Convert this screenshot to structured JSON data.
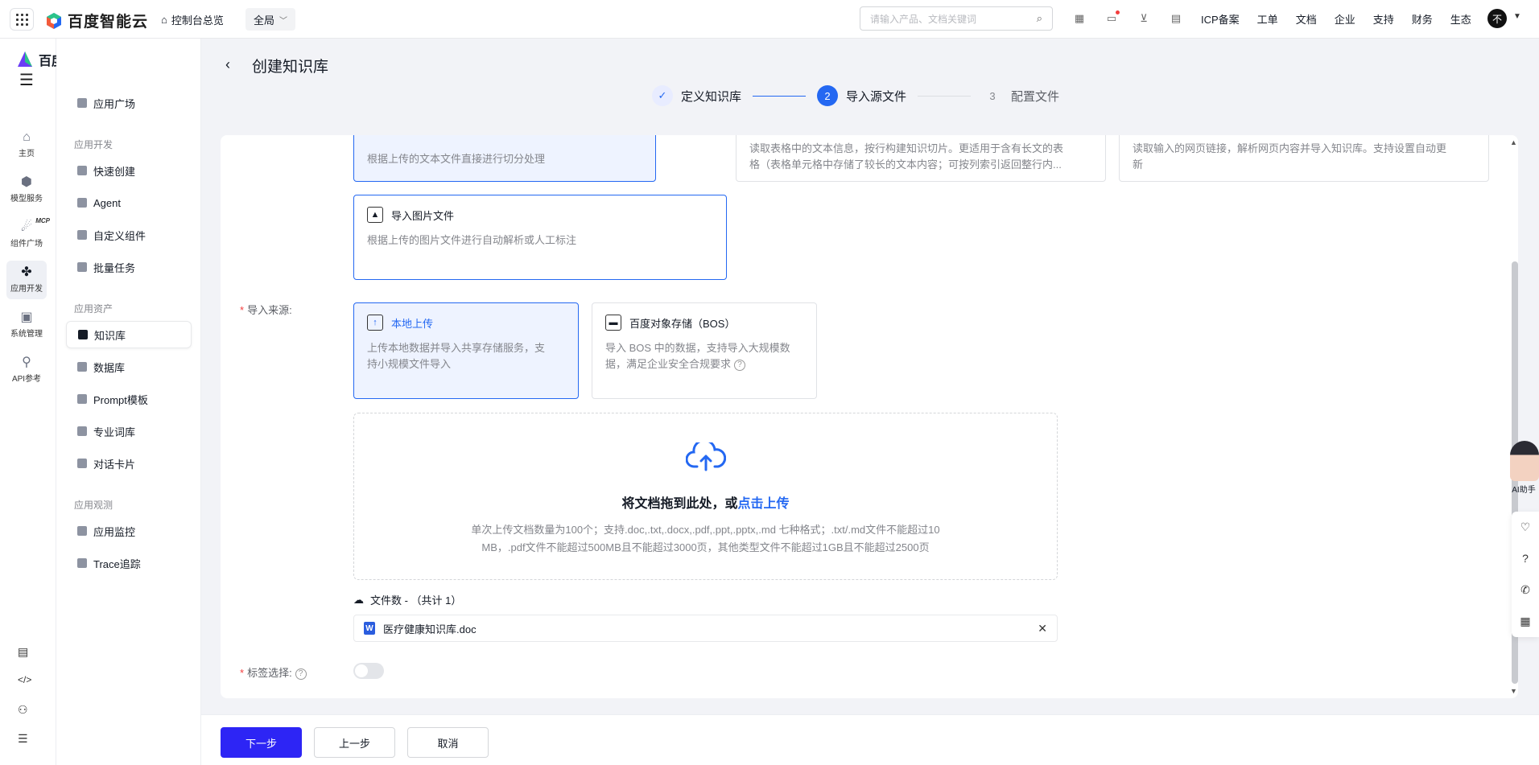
{
  "topbar": {
    "brand": "百度智能云",
    "console_label": "控制台总览",
    "region": "全局",
    "search_placeholder": "请输入产品、文档关键词",
    "links": [
      "ICP备案",
      "工单",
      "文档",
      "企业",
      "支持",
      "财务",
      "生态"
    ],
    "avatar_text": "不"
  },
  "rail": {
    "brand": "百度千帆",
    "items": [
      "主页",
      "模型服务",
      "组件广场",
      "应用开发",
      "系统管理",
      "API参考"
    ],
    "mcp_badge": "MCP"
  },
  "sidenav": {
    "top_item": "应用广场",
    "group_dev": "应用开发",
    "dev_items": [
      "快速创建",
      "Agent",
      "自定义组件",
      "批量任务"
    ],
    "group_assets": "应用资产",
    "asset_items": [
      "知识库",
      "数据库",
      "Prompt模板",
      "专业词库",
      "对话卡片"
    ],
    "group_observe": "应用观测",
    "observe_items": [
      "应用监控",
      "Trace追踪"
    ]
  },
  "page": {
    "title": "创建知识库",
    "steps": [
      {
        "num": "✓",
        "label": "定义知识库"
      },
      {
        "num": "2",
        "label": "导入源文件"
      },
      {
        "num": "3",
        "label": "配置文件"
      }
    ]
  },
  "cards_top": {
    "text_desc": "根据上传的文本文件直接进行切分处理",
    "table_desc_1": "读取表格中的文本信息，按行构建知识切片。更适用于含有长文的表",
    "table_desc_2": "格（表格单元格中存储了较长的文本内容；可按列索引返回整行内...",
    "web_desc_1": "读取输入的网页链接，解析网页内容并导入知识库。支持设置自动更",
    "web_desc_2": "新"
  },
  "image_card": {
    "title": "导入图片文件",
    "desc": "根据上传的图片文件进行自动解析或人工标注"
  },
  "source": {
    "label": "导入来源:",
    "local_title": "本地上传",
    "local_desc_1": "上传本地数据并导入共享存储服务，支",
    "local_desc_2": "持小规模文件导入",
    "bos_title": "百度对象存储（BOS）",
    "bos_desc_1": "导入 BOS 中的数据，支持导入大规模数",
    "bos_desc_2": "据，满足企业安全合规要求"
  },
  "dropzone": {
    "title_prefix": "将文档拖到此处，或",
    "title_link": "点击上传",
    "tip_1": "单次上传文档数量为100个；支持.doc,.txt,.docx,.pdf,.ppt,.pptx,.md 七种格式；.txt/.md文件不能超过10",
    "tip_2": "MB，.pdf文件不能超过500MB且不能超过3000页，其他类型文件不能超过1GB且不能超过2500页"
  },
  "files": {
    "count_label": "文件数 - （共计 1）",
    "items": [
      "医疗健康知识库.doc"
    ]
  },
  "tag": {
    "label": "标签选择:",
    "enabled": false
  },
  "footer": {
    "next": "下一步",
    "prev": "上一步",
    "cancel": "取消"
  },
  "assistant": {
    "label": "AI助手"
  },
  "colors": {
    "primary": "#2468f2",
    "primary_button": "#2d25f5",
    "required": "#f33e3e"
  }
}
